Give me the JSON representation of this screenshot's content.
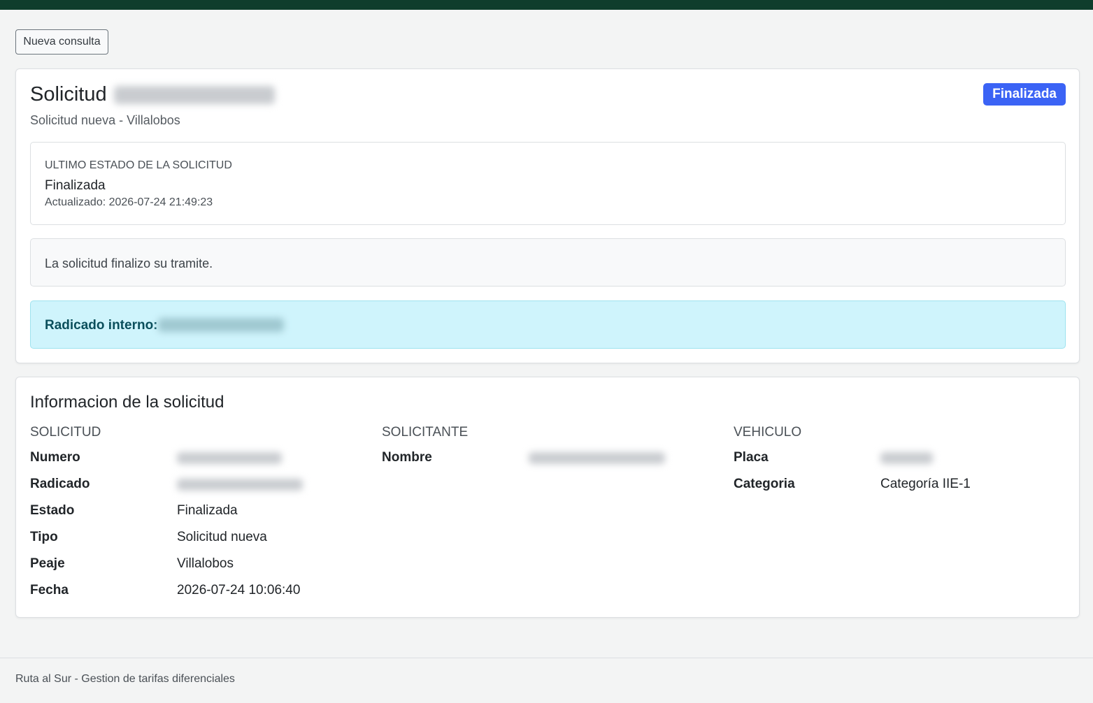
{
  "new_query_button": "Nueva consulta",
  "request": {
    "title": "Solicitud",
    "subtitle": "Solicitud nueva - Villalobos",
    "badge": "Finalizada",
    "status": {
      "label": "ULTIMO ESTADO DE LA SOLICITUD",
      "value": "Finalizada",
      "updated": "Actualizado: 2026-07-24 21:49:23"
    },
    "message": "La solicitud finalizo su tramite.",
    "internal_label": "Radicado interno:"
  },
  "info": {
    "title": "Informacion de la solicitud",
    "solicitud": {
      "heading": "SOLICITUD",
      "rows": [
        {
          "key": "Numero",
          "value": ""
        },
        {
          "key": "Radicado",
          "value": ""
        },
        {
          "key": "Estado",
          "value": "Finalizada"
        },
        {
          "key": "Tipo",
          "value": "Solicitud nueva"
        },
        {
          "key": "Peaje",
          "value": "Villalobos"
        },
        {
          "key": "Fecha",
          "value": "2026-07-24 10:06:40"
        }
      ]
    },
    "solicitante": {
      "heading": "SOLICITANTE",
      "rows": [
        {
          "key": "Nombre",
          "value": ""
        }
      ]
    },
    "vehiculo": {
      "heading": "VEHICULO",
      "rows": [
        {
          "key": "Placa",
          "value": ""
        },
        {
          "key": "Categoria",
          "value": "Categoría IIE-1"
        }
      ]
    }
  },
  "footer": "Ruta al Sur - Gestion de tarifas diferenciales",
  "colors": {
    "topbar": "#0f3d2c",
    "badge": "#3b63f5",
    "info_bg": "#cff4fc",
    "info_text": "#0b4f5c"
  }
}
